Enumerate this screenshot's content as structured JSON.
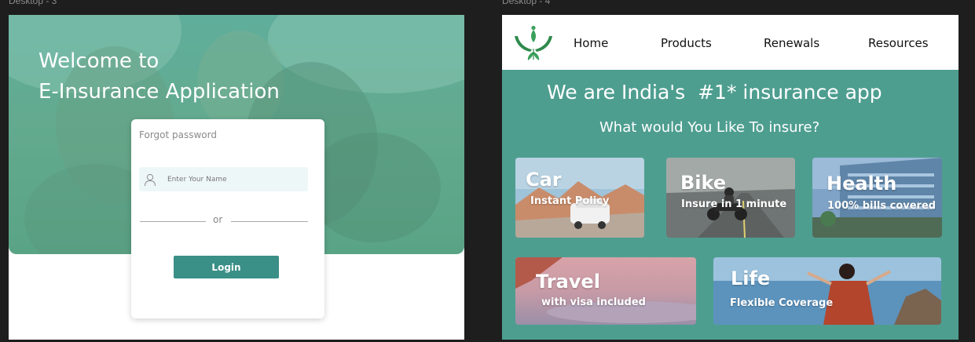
{
  "frames": {
    "desktop3": "Desktop - 3",
    "desktop4": "Desktop - 4"
  },
  "login": {
    "welcome_line1": "Welcome to",
    "welcome_line2": "E-Insurance Application",
    "card_title": "Forgot password",
    "name_placeholder": "Enter Your Name",
    "or_text": "or",
    "login_button": "Login"
  },
  "home": {
    "nav": [
      "Home",
      "Products",
      "Renewals",
      "Resources"
    ],
    "headline": "We are India's  #1* insurance app",
    "subheadline": "What would You Like To insure?",
    "tiles": [
      {
        "title": "Car",
        "subtitle": "Instant Policy"
      },
      {
        "title": "Bike",
        "subtitle": "Insure in 1 minute"
      },
      {
        "title": "Health",
        "subtitle": "100% bills covered"
      },
      {
        "title": "Travel",
        "subtitle": "with visa included"
      },
      {
        "title": "Life",
        "subtitle": "Flexible Coverage"
      }
    ]
  },
  "colors": {
    "teal_primary": "#4e9e90",
    "login_button": "#3a8f86",
    "input_bg": "#eef7f7",
    "logo_green": "#3aa05a"
  },
  "icons": {
    "user_field": "user-icon",
    "brand": "hands-leaf-logo-icon"
  }
}
